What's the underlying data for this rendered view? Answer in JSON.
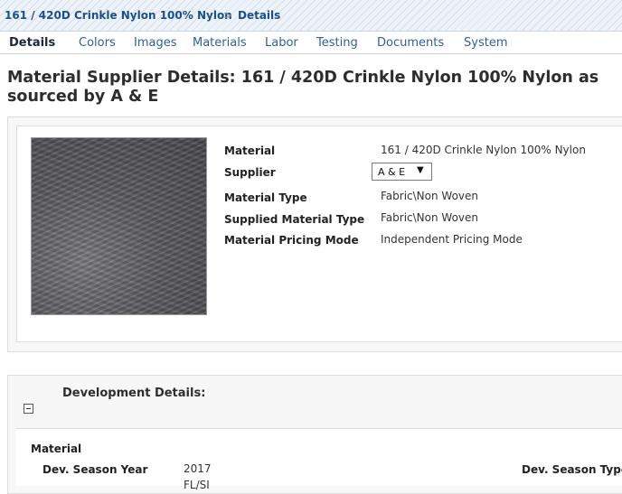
{
  "breadcrumb": {
    "item": "161 / 420D Crinkle Nylon 100% Nylon",
    "separator": ">",
    "current": "Details"
  },
  "tabs": [
    {
      "label": "Details",
      "active": true
    },
    {
      "label": "Colors"
    },
    {
      "label": "Images"
    },
    {
      "label": "Materials"
    },
    {
      "label": "Labor"
    },
    {
      "label": "Testing"
    },
    {
      "label": "Documents"
    },
    {
      "label": "System"
    }
  ],
  "page": {
    "title": "Material Supplier Details: 161 / 420D Crinkle Nylon 100% Nylon as sourced by A & E"
  },
  "details": {
    "fields": [
      {
        "label": "Material",
        "value": "161 / 420D Crinkle Nylon  100% Nylon"
      },
      {
        "label": "Supplier",
        "value": "A & E"
      },
      {
        "label": "Material Type",
        "value": "Fabric\\Non Woven"
      },
      {
        "label": "Supplied Material Type",
        "value": "Fabric\\Non Woven"
      },
      {
        "label": "Material Pricing Mode",
        "value": "Independent Pricing Mode"
      }
    ],
    "supplier_arrow": "▼"
  },
  "development": {
    "heading": "Development Details:",
    "section": "Material",
    "season_year_label": "Dev. Season Year",
    "season_year_value": "2017",
    "partial_value": "FL/SI",
    "season_type_label": "Dev. Season Type"
  },
  "colors": {
    "breadcrumb": "#1b4f8c",
    "tab_link": "#2f5f9a",
    "panel_bg": "#f7f7f7"
  }
}
